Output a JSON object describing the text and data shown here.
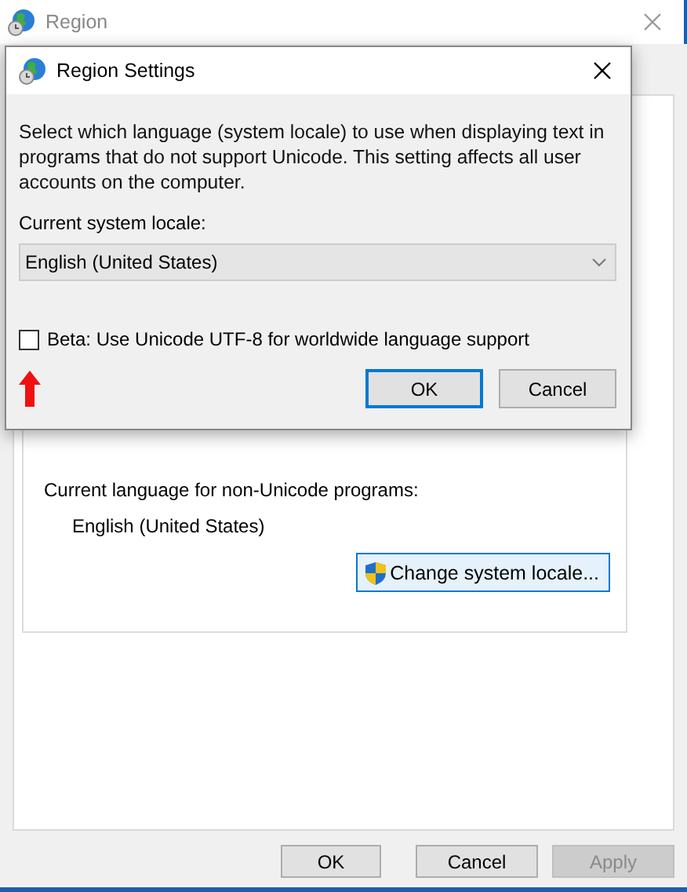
{
  "window": {
    "title": "Region"
  },
  "locale_group": {
    "label": "Current language for non-Unicode programs:",
    "value": "English (United States)",
    "button": "Change system locale..."
  },
  "buttons": [
    {
      "label": "OK",
      "disabled": false
    },
    {
      "label": "Cancel",
      "disabled": false
    },
    {
      "label": "Apply",
      "disabled": true
    }
  ],
  "dialog": {
    "title": "Region Settings",
    "description": "Select which language (system locale) to use when displaying text in programs that do not support Unicode. This setting affects all user accounts on the computer.",
    "locale_label": "Current system locale:",
    "locale_value": "English (United States)",
    "beta_option": {
      "label": "Beta: Use Unicode UTF-8 for worldwide language support",
      "checked": false
    },
    "buttons": [
      {
        "label": "OK",
        "default": true
      },
      {
        "label": "Cancel",
        "default": false
      }
    ]
  }
}
